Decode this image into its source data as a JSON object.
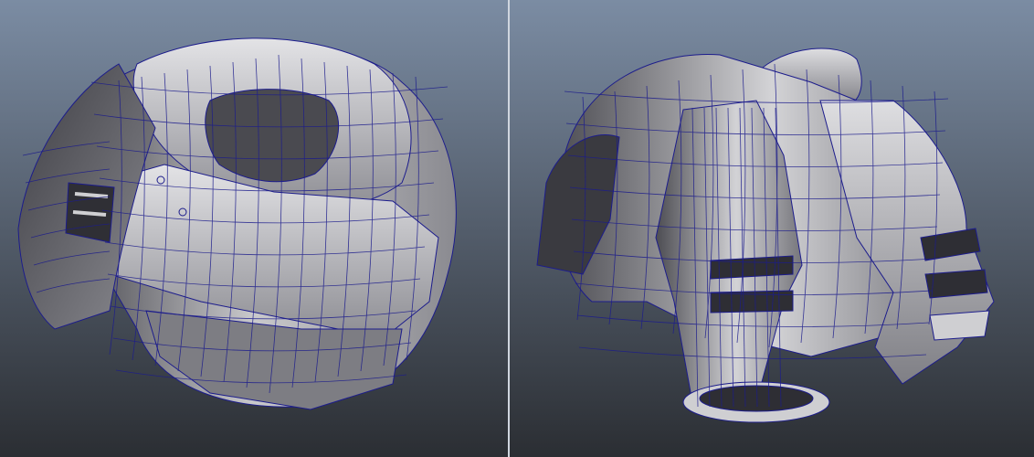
{
  "scene": {
    "background_top": "#7b8ca3",
    "background_bottom": "#2b2e33",
    "divider_color": "#d0d6df",
    "wire_color": "#1c1c8c",
    "surface_light": "#d6d6d8",
    "surface_mid": "#9b9ba0",
    "surface_dark": "#4e4e54"
  },
  "views": [
    {
      "id": "front-three-quarter",
      "model": "armor-chest-shoulder-mesh"
    },
    {
      "id": "back-three-quarter",
      "model": "armor-chest-shoulder-mesh"
    }
  ]
}
